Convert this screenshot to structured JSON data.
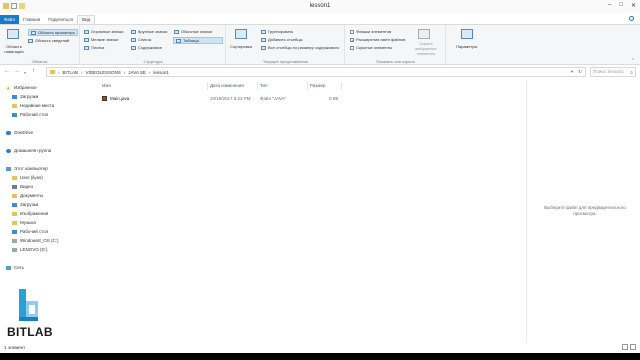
{
  "window": {
    "title": "lesson1",
    "controls": {
      "minimize": "–",
      "maximize": "□",
      "close": "✕"
    }
  },
  "ribbon_tabs": [
    {
      "label": "Файл"
    },
    {
      "label": "Главная"
    },
    {
      "label": "Поделиться"
    },
    {
      "label": "Вид"
    }
  ],
  "ribbon": {
    "panels_group": {
      "label": "Области",
      "nav_pane": "Область навигации",
      "preview_pane": "Область просмотра",
      "details_pane": "Область сведений"
    },
    "layout_group": {
      "label": "Структура",
      "items": [
        "Огромные значки",
        "Крупные значки",
        "Обычные значки",
        "Мелкие значки",
        "Список",
        "Таблица",
        "Плитка",
        "Содержимое"
      ],
      "selected": "Таблица"
    },
    "view_group": {
      "label": "Текущее представление",
      "sort": "Сортировка",
      "group_by": "Группировать",
      "add_columns": "Добавить столбцы",
      "size_columns": "Все столбцы по размеру содержимого"
    },
    "showhide_group": {
      "label": "Показать или скрыть",
      "item_checkboxes": "Флажки элементов",
      "extensions": "Расширения имен файлов",
      "hidden_items": "Скрытые элементы",
      "hide_selected": "Скрыть выбранные элементы",
      "extensions_checked": true
    },
    "options": "Параметры"
  },
  "address": {
    "crumbs": [
      "BITLAB",
      "VIDEOLESSONS",
      "JAVA SE",
      "lesson1"
    ],
    "search_placeholder": "Поиск: lesson1"
  },
  "nav_pane": {
    "favorites": "Избранное",
    "favorites_items": [
      "Загрузки",
      "Недавние места",
      "Рабочий стол"
    ],
    "onedrive": "OneDrive",
    "homegroup": "Домашняя группа",
    "this_pc": "Этот компьютер",
    "this_pc_items": [
      "User (ilyas)",
      "Видео",
      "Документы",
      "Загрузки",
      "Изображения",
      "Музыка",
      "Рабочий стол",
      "Windows8_OS (C:)",
      "LENOVO (D:)"
    ],
    "network": "Сеть"
  },
  "columns": {
    "name": "Имя",
    "date": "Дата изменения",
    "type": "Тип",
    "size": "Размер"
  },
  "files": [
    {
      "name": "Main.java",
      "date": "10/19/2017 6:23 PM",
      "type": "Файл \"JAVA\"",
      "size": "0 КБ"
    }
  ],
  "preview_text": "Выберите файл для предварительного просмотра.",
  "status": {
    "count": "1 элемент"
  },
  "logo": {
    "text": "BITLAB"
  },
  "colors": {
    "accent": "#1979ca",
    "selection": "#cce4f7",
    "logo_blue": "#2a9fd8"
  }
}
